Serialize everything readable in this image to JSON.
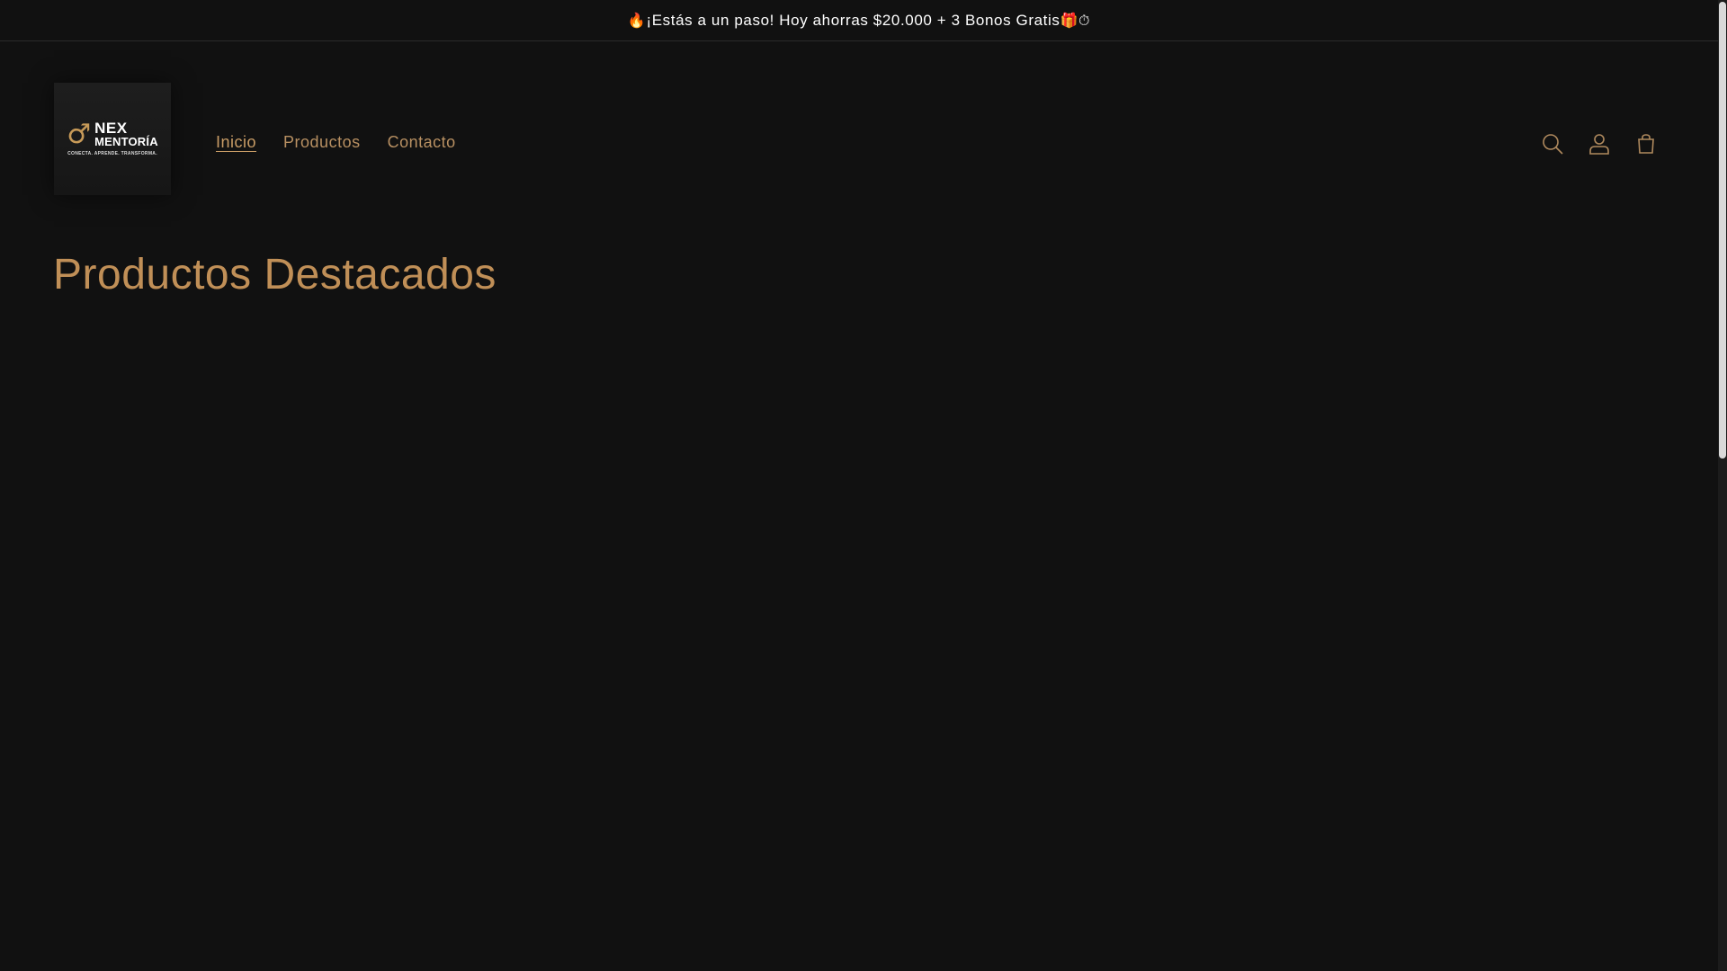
{
  "announcement": {
    "prefix_emoji": "🔥",
    "text": "¡Estás a un paso! Hoy ahorras $20.000 + 3 Bonos Gratis",
    "suffix_emoji": "🎁⏱"
  },
  "header": {
    "logo": {
      "symbol": "♂",
      "line1": "NEX",
      "line2": "MENTORÍA",
      "tagline": "CONECTA. APRENDE. TRANSFORMA."
    },
    "nav": [
      {
        "label": "Inicio",
        "active": true
      },
      {
        "label": "Productos",
        "active": false
      },
      {
        "label": "Contacto",
        "active": false
      }
    ],
    "icons": [
      "search-icon",
      "account-icon",
      "cart-icon"
    ]
  },
  "main": {
    "title": "Productos Destacados"
  },
  "colors": {
    "background": "#111111",
    "accent": "#c08f57",
    "text": "#ffffff"
  }
}
